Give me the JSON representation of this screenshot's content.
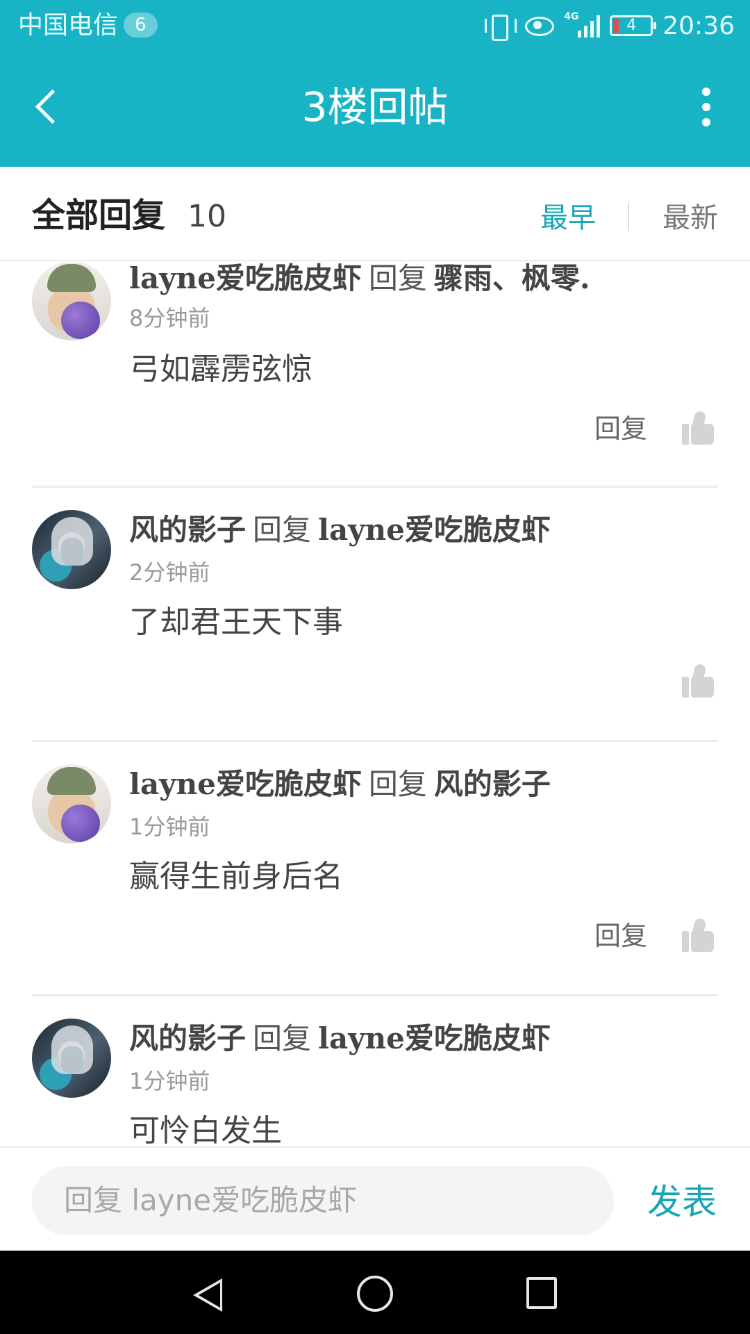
{
  "status_bar": {
    "carrier": "中国电信",
    "carrier_badge": "6",
    "network": "4G",
    "battery": "4",
    "time": "20:36"
  },
  "header": {
    "title": "3楼回帖",
    "back_icon": "chevron-left-icon",
    "more_icon": "more-vertical-icon"
  },
  "sub_header": {
    "all_replies_label": "全部回复",
    "count": "10",
    "sort_earliest": "最早",
    "sort_newest": "最新",
    "active_sort_color": "#18a5b5"
  },
  "replies": [
    {
      "avatar": "kid-avatar",
      "user": "layne爱吃脆皮虾",
      "verb": "回复",
      "target": "骤雨、枫零.",
      "time": "8分钟前",
      "text": "弓如霹雳弦惊",
      "reply_label": "回复",
      "show_reply": true
    },
    {
      "avatar": "hero-avatar",
      "user": "风的影子",
      "verb": "回复",
      "target": "layne爱吃脆皮虾",
      "time": "2分钟前",
      "text": "了却君王天下事",
      "reply_label": "",
      "show_reply": false
    },
    {
      "avatar": "kid-avatar",
      "user": "layne爱吃脆皮虾",
      "verb": "回复",
      "target": "风的影子",
      "time": "1分钟前",
      "text": "赢得生前身后名",
      "reply_label": "回复",
      "show_reply": true
    },
    {
      "avatar": "hero-avatar",
      "user": "风的影子",
      "verb": "回复",
      "target": "layne爱吃脆皮虾",
      "time": "1分钟前",
      "text": "可怜白发生",
      "reply_label": "",
      "show_reply": false
    }
  ],
  "input_bar": {
    "placeholder": "回复 layne爱吃脆皮虾",
    "publish_label": "发表"
  },
  "colors": {
    "brand": "#18b4c6",
    "accent": "#18a5b5"
  }
}
